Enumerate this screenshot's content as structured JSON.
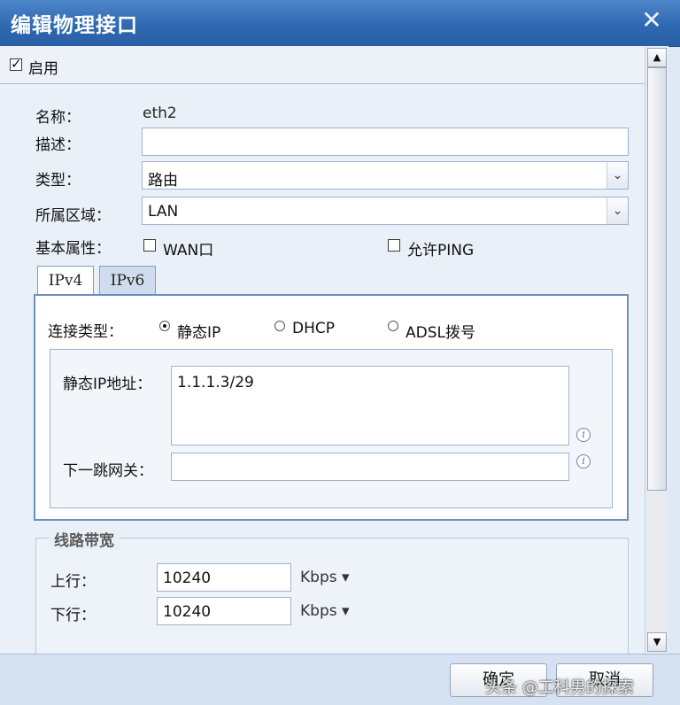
{
  "dialog": {
    "title": "编辑物理接口",
    "close_glyph": "✕"
  },
  "enable": {
    "label": "启用",
    "checked": true
  },
  "form": {
    "name_label": "名称：",
    "name_value": "eth2",
    "desc_label": "描述：",
    "desc_value": "",
    "type_label": "类型：",
    "type_value": "路由",
    "zone_label": "所属区域：",
    "zone_value": "LAN",
    "basic_label": "基本属性：",
    "wan_label": "WAN口",
    "wan_checked": false,
    "ping_label": "允许PING",
    "ping_checked": false
  },
  "tabs": [
    {
      "label": "IPv4",
      "active": true
    },
    {
      "label": "IPv6",
      "active": false
    }
  ],
  "ipv4": {
    "conn_type_label": "连接类型：",
    "options": [
      {
        "label": "静态IP",
        "selected": true
      },
      {
        "label": "DHCP",
        "selected": false
      },
      {
        "label": "ADSL拨号",
        "selected": false
      }
    ],
    "static_ip_label": "静态IP地址：",
    "static_ip_value": "1.1.1.3/29",
    "gateway_label": "下一跳网关：",
    "gateway_value": ""
  },
  "bandwidth": {
    "legend": "线路带宽",
    "up_label": "上行：",
    "up_value": "10240",
    "up_unit": "Kbps ▾",
    "down_label": "下行：",
    "down_value": "10240",
    "down_unit": "Kbps ▾"
  },
  "footer": {
    "confirm_label": "确定",
    "cancel_label": "取消",
    "watermark": "头条 @工科男的探索"
  },
  "scrollbar": {
    "up_glyph": "▲",
    "down_glyph": "▼"
  },
  "icons": {
    "info": "i"
  }
}
